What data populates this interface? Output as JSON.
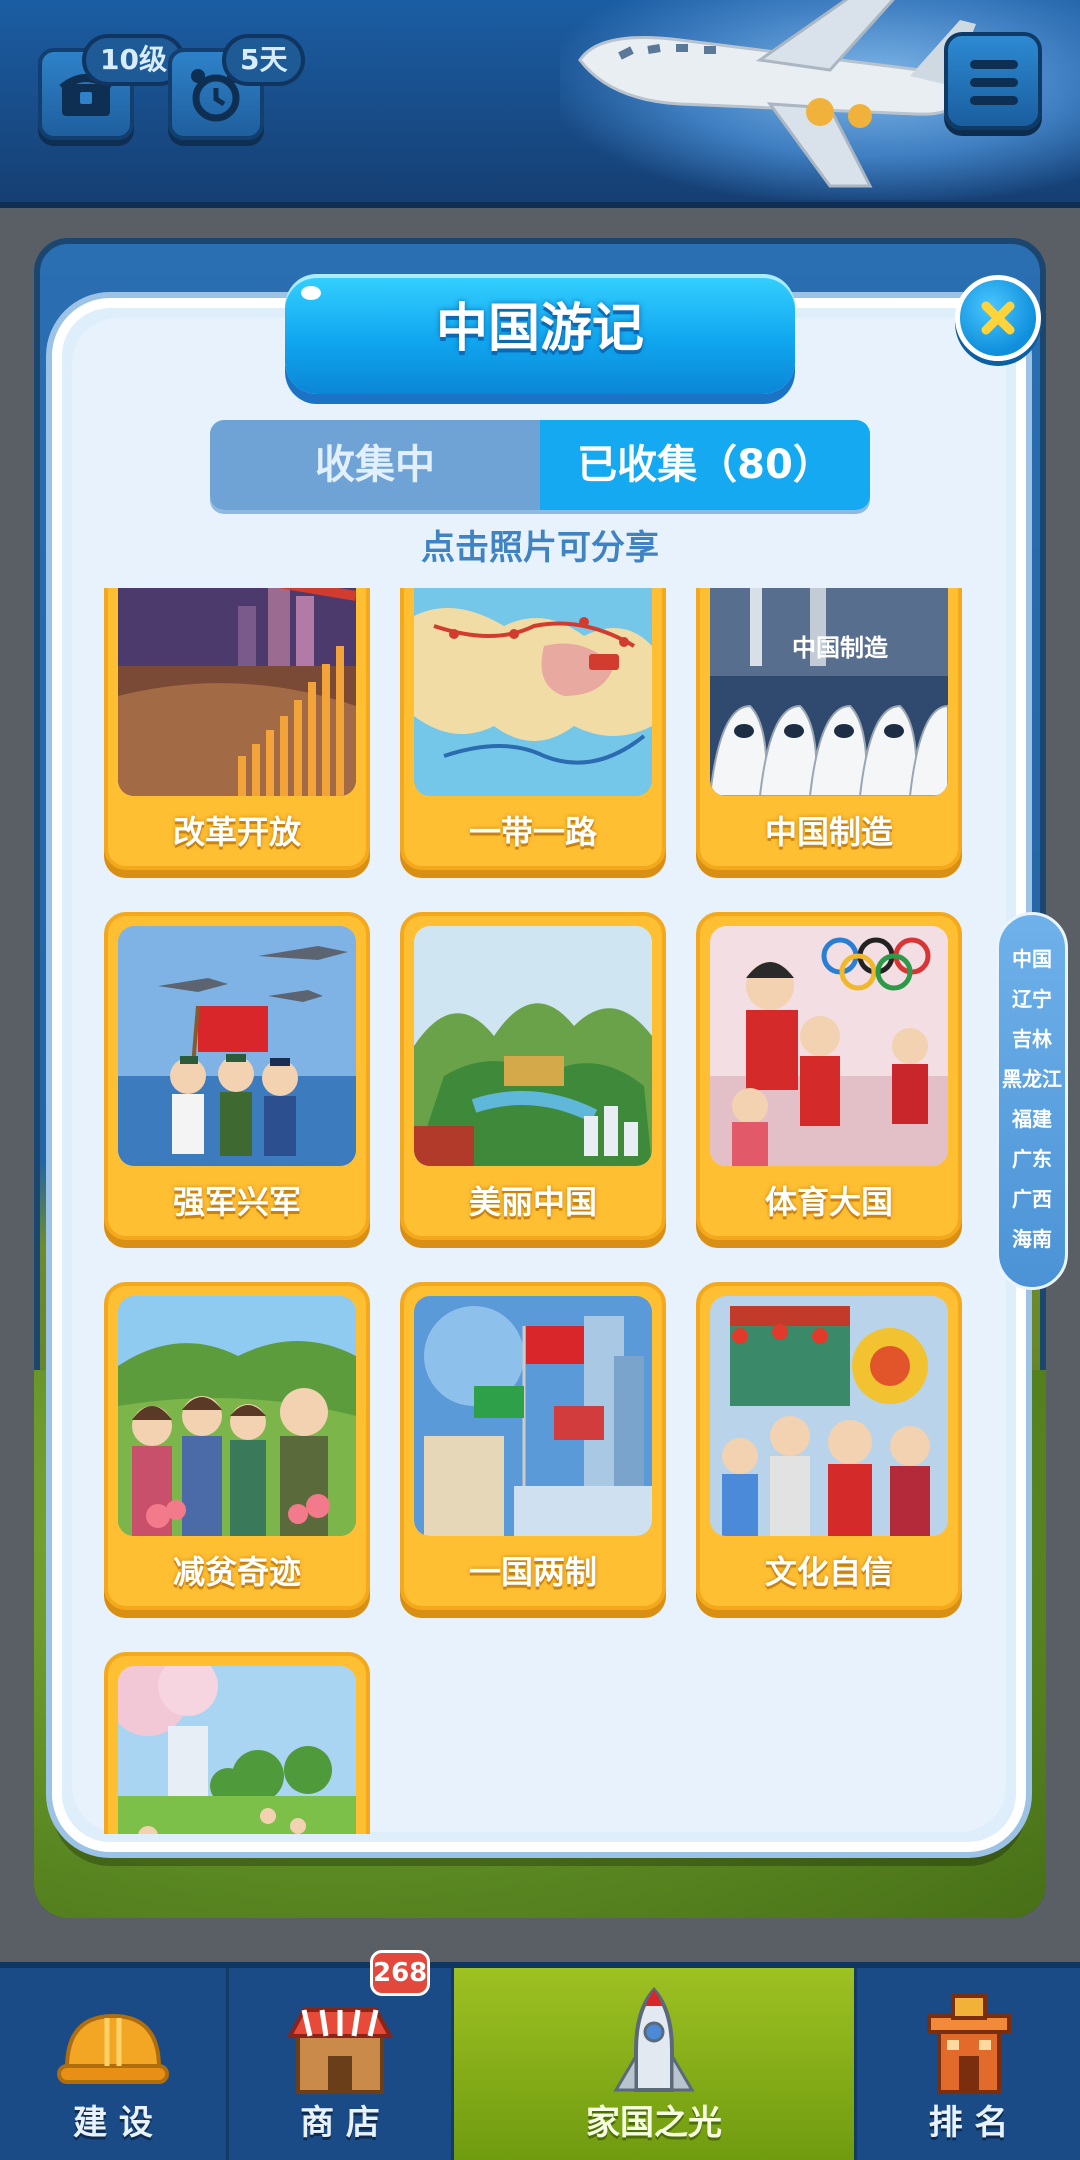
{
  "hud": {
    "level_badge": "10级",
    "days_badge": "5天"
  },
  "modal": {
    "title": "中国游记",
    "tabs": [
      {
        "label": "收集中",
        "active": false
      },
      {
        "label": "已收集（80）",
        "active": true
      }
    ],
    "hint": "点击照片可分享",
    "cards": [
      {
        "label": "改革开放",
        "image": "reform-opening-photo"
      },
      {
        "label": "一带一路",
        "image": "belt-and-road-map"
      },
      {
        "label": "中国制造",
        "image": "made-in-china-trains"
      },
      {
        "label": "强军兴军",
        "image": "military-strength"
      },
      {
        "label": "美丽中国",
        "image": "beautiful-china-landscape"
      },
      {
        "label": "体育大国",
        "image": "sports-olympic-rings"
      },
      {
        "label": "减贫奇迹",
        "image": "poverty-reduction-villagers"
      },
      {
        "label": "一国两制",
        "image": "one-country-two-systems-flags"
      },
      {
        "label": "文化自信",
        "image": "cultural-confidence-lion-dance"
      },
      {
        "label": "",
        "image": "park-cherry-blossom"
      }
    ]
  },
  "side_index": [
    "中国",
    "辽宁",
    "吉林",
    "黑龙江",
    "福建",
    "广东",
    "广西",
    "海南"
  ],
  "bottom_nav": [
    {
      "label": "建 设",
      "icon": "hard-hat-icon"
    },
    {
      "label": "商 店",
      "icon": "shop-icon",
      "badge": "268"
    },
    {
      "label": "家国之光",
      "icon": "rocket-icon",
      "active": true
    },
    {
      "label": "排 名",
      "icon": "ranking-building-icon"
    }
  ],
  "colors": {
    "accent_blue": "#14a9f1",
    "card_yellow": "#ffbf33",
    "nav_active": "#8db81c"
  }
}
